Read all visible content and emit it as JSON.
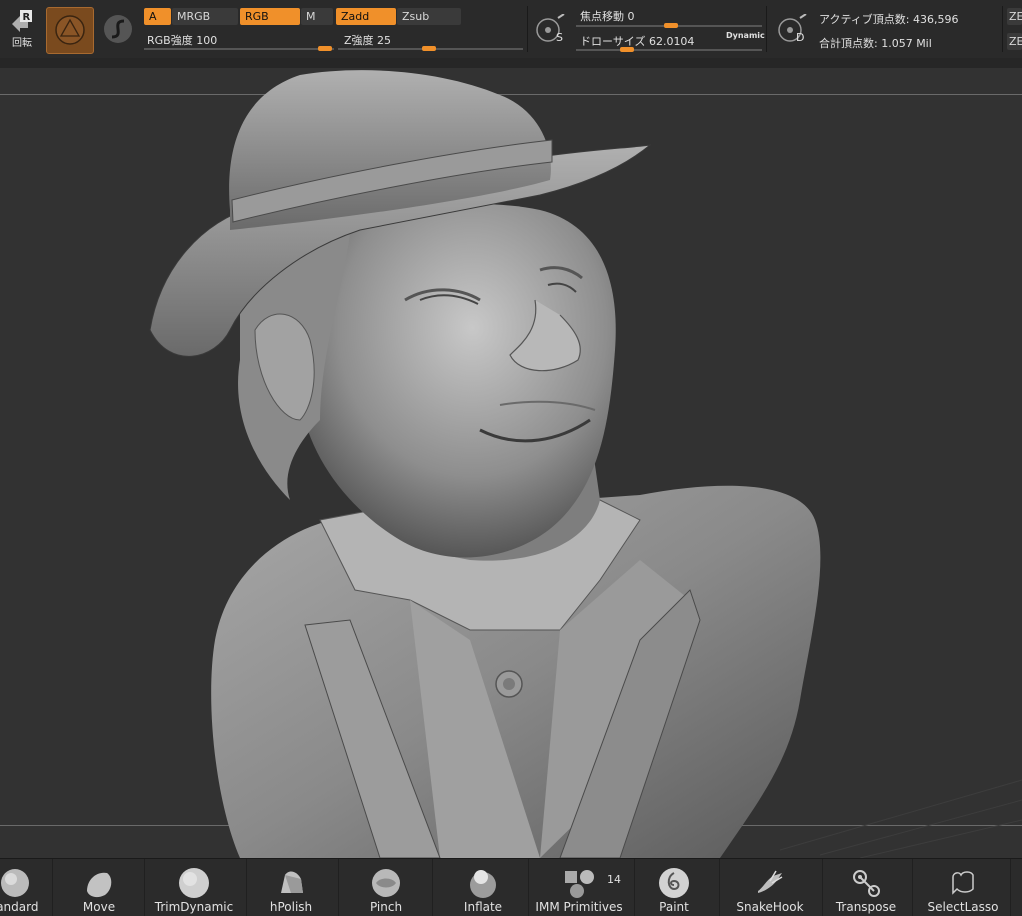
{
  "topbar": {
    "rotate_label": "回転",
    "rotate_key": "R",
    "chip_a": "A",
    "mrgb": "MRGB",
    "rgb": "RGB",
    "m": "M",
    "zadd": "Zadd",
    "zsub": "Zsub",
    "rgb_intensity": "RGB強度 100",
    "z_intensity": "Z強度 25",
    "focal_shift": "焦点移動 0",
    "draw_size": "ドローサイズ 62.0104",
    "dynamic": "Dynamic",
    "s_key": "S",
    "d_key": "D",
    "active_points": "アクティブ頂点数: 436,596",
    "total_points": "合計頂点数: 1.057 Mil",
    "ze_label": "ZE"
  },
  "tools": [
    {
      "name": "tandard",
      "icon": "standard-brush-icon"
    },
    {
      "name": "Move",
      "icon": "move-brush-icon"
    },
    {
      "name": "TrimDynamic",
      "icon": "trimdynamic-brush-icon"
    },
    {
      "name": "hPolish",
      "icon": "hpolish-brush-icon"
    },
    {
      "name": "Pinch",
      "icon": "pinch-brush-icon"
    },
    {
      "name": "Inflate",
      "icon": "inflate-brush-icon"
    },
    {
      "name": "IMM Primitives",
      "icon": "imm-primitives-icon",
      "badge": "14"
    },
    {
      "name": "Paint",
      "icon": "paint-brush-icon"
    },
    {
      "name": "SnakeHook",
      "icon": "snakehook-brush-icon"
    },
    {
      "name": "Transpose",
      "icon": "transpose-icon"
    },
    {
      "name": "SelectLasso",
      "icon": "selectlasso-icon"
    }
  ],
  "colors": {
    "accent": "#f0902a",
    "viewport": "#323232",
    "panel": "#2a2a2a"
  }
}
